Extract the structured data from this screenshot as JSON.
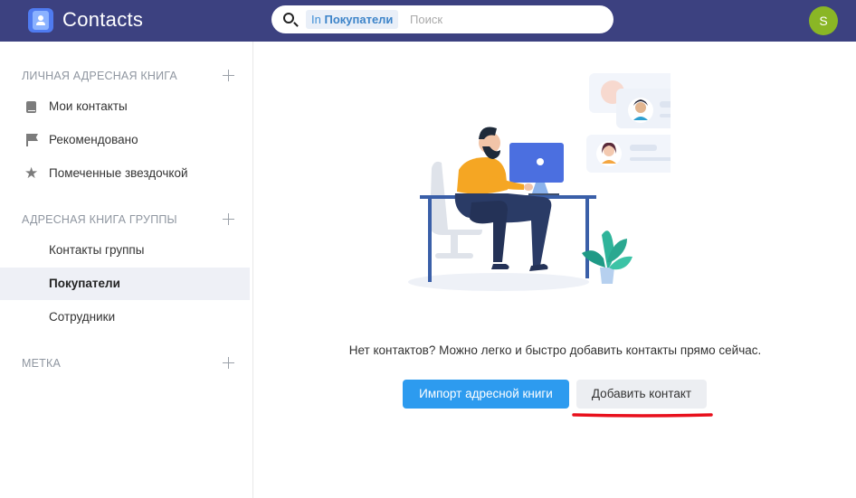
{
  "app": {
    "title": "Contacts"
  },
  "search": {
    "scope_prefix": "In",
    "scope_name": "Покупатели",
    "placeholder": "Поиск"
  },
  "user": {
    "avatar_letter": "S",
    "avatar_color": "#8ab625"
  },
  "sidebar": {
    "sections": [
      {
        "title": "ЛИЧНАЯ АДРЕСНАЯ КНИГА",
        "items": [
          {
            "label": "Мои контакты",
            "icon": "book-icon"
          },
          {
            "label": "Рекомендовано",
            "icon": "flag-icon"
          },
          {
            "label": "Помеченные звездочкой",
            "icon": "star-icon"
          }
        ]
      },
      {
        "title": "АДРЕСНАЯ КНИГА ГРУППЫ",
        "items": [
          {
            "label": "Контакты группы"
          },
          {
            "label": "Покупатели",
            "active": true
          },
          {
            "label": "Сотрудники"
          }
        ]
      },
      {
        "title": "МЕТКА",
        "items": []
      }
    ]
  },
  "main": {
    "empty_message": "Нет контактов? Можно легко и быстро добавить контакты прямо сейчас.",
    "import_button": "Импорт адресной книги",
    "add_button": "Добавить контакт"
  },
  "colors": {
    "topbar": "#3c4180",
    "accent": "#2d9bef",
    "annotation": "#e8101c"
  }
}
